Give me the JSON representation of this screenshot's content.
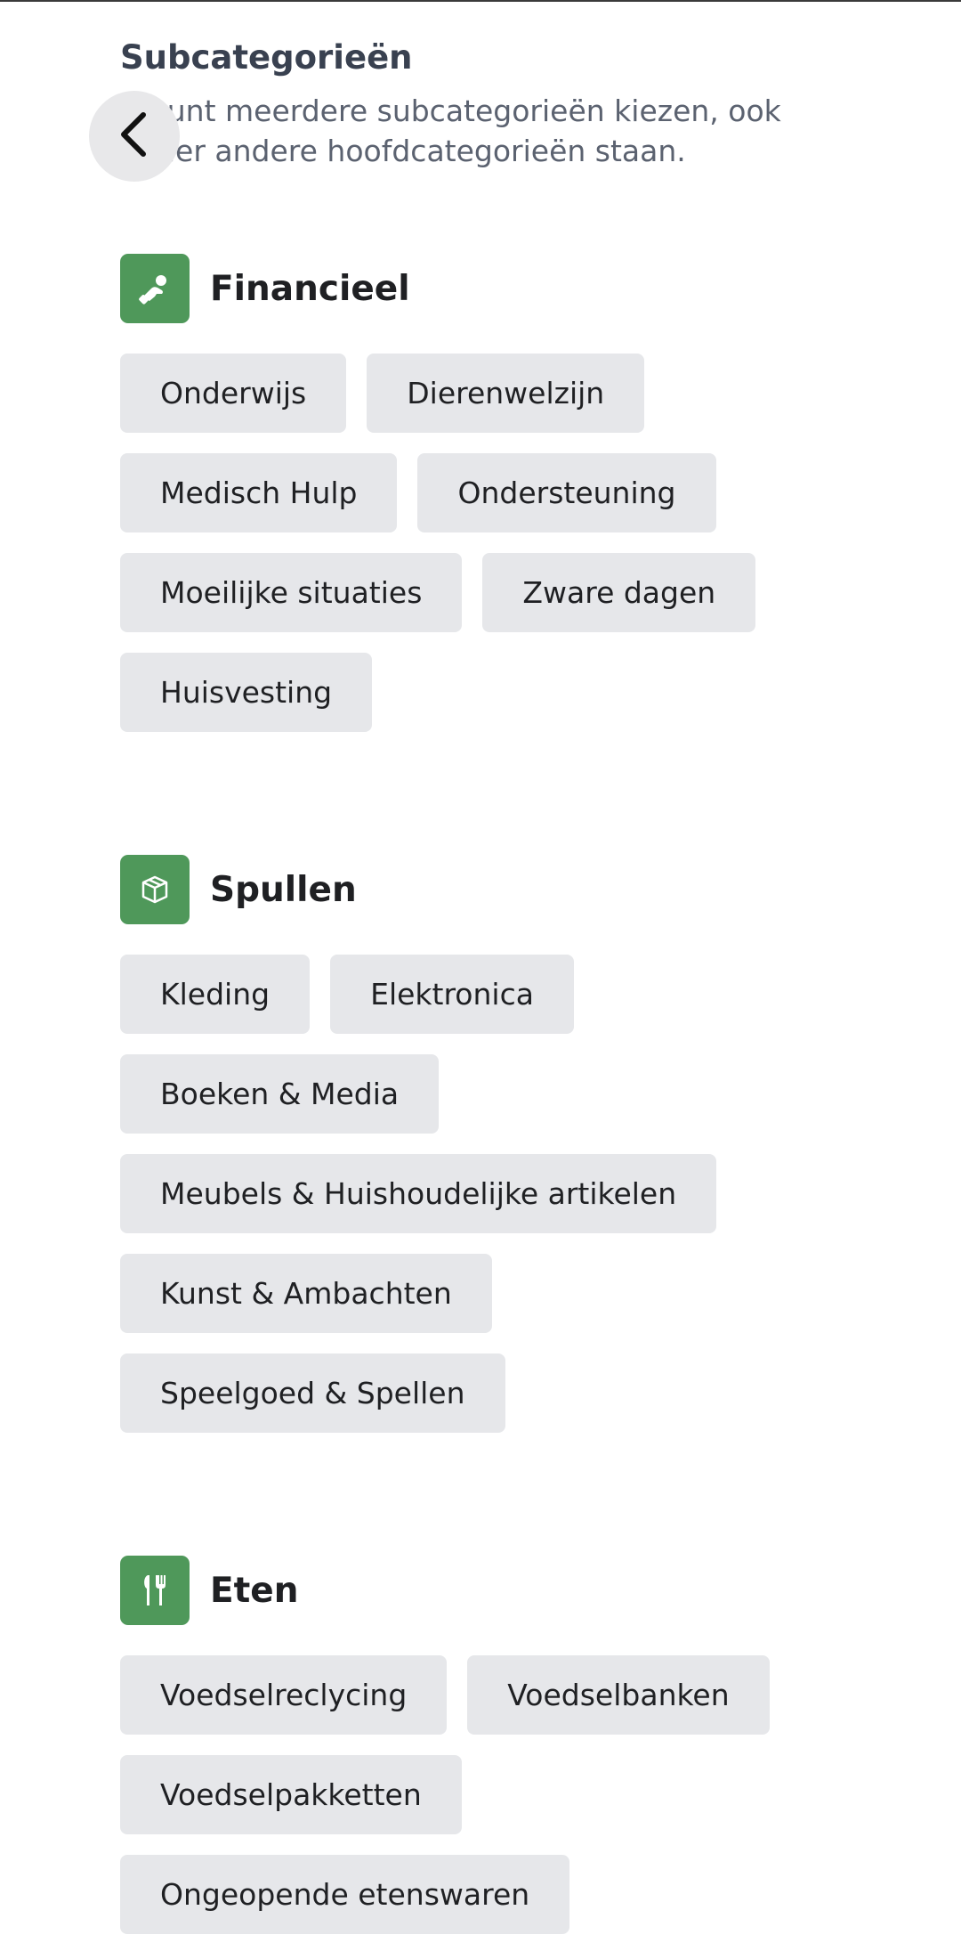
{
  "header": {
    "title": "Subcategorieën",
    "subtitle": "U kunt meerdere subcategorieën kiezen, ook onder andere hoofdcategorieën staan."
  },
  "back_button": {
    "icon": "chevron-left-icon"
  },
  "accent_color": "#4f985a",
  "sections": [
    {
      "title": "Financieel",
      "icon": "hand-coin-icon",
      "chips": [
        "Onderwijs",
        "Dierenwelzijn",
        "Medisch Hulp",
        "Ondersteuning",
        "Moeilijke situaties",
        "Zware dagen",
        "Huisvesting"
      ]
    },
    {
      "title": "Spullen",
      "icon": "box-icon",
      "chips": [
        "Kleding",
        "Elektronica",
        "Boeken & Media",
        "Meubels & Huishoudelijke artikelen",
        "Kunst & Ambachten",
        "Speelgoed & Spellen"
      ]
    },
    {
      "title": "Eten",
      "icon": "fork-knife-icon",
      "chips": [
        "Voedselreclycing",
        "Voedselbanken",
        "Voedselpakketten",
        "Ongeopende etenswaren"
      ]
    }
  ]
}
